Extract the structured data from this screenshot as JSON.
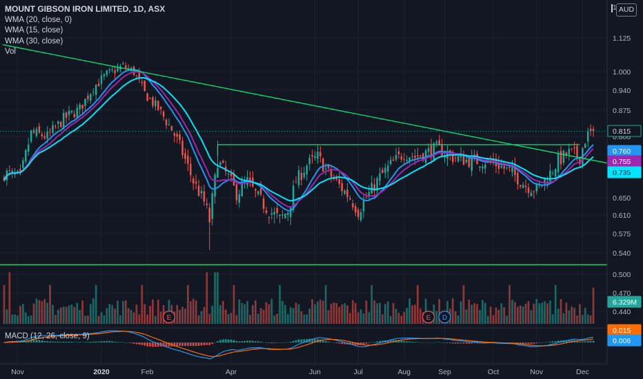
{
  "chart_data": {
    "type": "candlestick",
    "title": "MOUNT GIBSON IRON LIMITED, 1D, ASX",
    "currency": "AUD",
    "indicators": [
      "WMA (20, close, 0)",
      "WMA (15, close)",
      "WMA (30, close)",
      "Vol"
    ],
    "macd_label": "MACD (12, 26, close, 9)",
    "price_axis_ticks": [
      1.125,
      1.0,
      0.94,
      0.875,
      0.8,
      0.65,
      0.61,
      0.575,
      0.54,
      0.5,
      0.47,
      0.44
    ],
    "price_axis_labels": [
      "1.125",
      "1.000",
      "0.940",
      "0.875",
      "0.800",
      "0.650",
      "0.610",
      "0.575",
      "0.540",
      "0.500",
      "0.470",
      "0.440"
    ],
    "time_axis_labels": [
      "Nov",
      "2020",
      "Feb",
      "Apr",
      "Jun",
      "Jul",
      "Aug",
      "Sep",
      "Oct",
      "Nov",
      "Dec"
    ],
    "time_axis_index": [
      5,
      36,
      53,
      84,
      115,
      131,
      148,
      163,
      181,
      197,
      214
    ],
    "ylim": [
      0.43,
      1.17
    ],
    "bars": 219,
    "last_close": 0.815,
    "price_badges": [
      {
        "label": "0.815",
        "value": 0.815,
        "color": "#26a69a",
        "style": "outline"
      },
      {
        "label": "0.760",
        "value": 0.76,
        "color": "#2196f3",
        "style": "filled"
      },
      {
        "label": "0.755",
        "value": 0.755,
        "color": "#9c27b0",
        "style": "filled"
      },
      {
        "label": "0.735",
        "value": 0.735,
        "color": "#00e5ff",
        "style": "filled"
      }
    ],
    "volume_badge": {
      "label": "6.329M",
      "color": "#26a69a"
    },
    "macd_badges": [
      {
        "label": "0.015",
        "color": "#ff6d00"
      },
      {
        "label": "0.006",
        "color": "#2196f3"
      }
    ],
    "event_markers": [
      {
        "label": "E",
        "index": 61,
        "color": "#ef5350"
      },
      {
        "label": "E",
        "index": 157,
        "color": "#ef5350"
      },
      {
        "label": "D",
        "index": 163,
        "color": "#2196f3"
      }
    ],
    "trendlines": [
      {
        "kind": "descending",
        "from": {
          "index": 0,
          "price": 1.1
        },
        "to": {
          "index": 219,
          "price": 0.735
        },
        "color": "#00e676"
      },
      {
        "kind": "horizontal-resistance",
        "from": {
          "index": 79
        },
        "to": {
          "index": 213
        },
        "price": 0.78,
        "color": "#00e676"
      },
      {
        "kind": "horizontal-support",
        "price": 0.518,
        "color": "#00e676"
      }
    ],
    "price_path": [
      [
        0,
        0.71
      ],
      [
        6,
        0.7
      ],
      [
        10,
        0.81
      ],
      [
        16,
        0.8
      ],
      [
        22,
        0.85
      ],
      [
        28,
        0.88
      ],
      [
        33,
        0.95
      ],
      [
        38,
        0.99
      ],
      [
        44,
        1.02
      ],
      [
        48,
        1.0
      ],
      [
        52,
        0.93
      ],
      [
        57,
        0.88
      ],
      [
        62,
        0.82
      ],
      [
        66,
        0.76
      ],
      [
        70,
        0.69
      ],
      [
        74,
        0.64
      ],
      [
        76,
        0.6
      ],
      [
        79,
        0.74
      ],
      [
        83,
        0.7
      ],
      [
        86,
        0.66
      ],
      [
        90,
        0.69
      ],
      [
        94,
        0.65
      ],
      [
        98,
        0.62
      ],
      [
        102,
        0.6
      ],
      [
        105,
        0.62
      ],
      [
        108,
        0.69
      ],
      [
        112,
        0.73
      ],
      [
        116,
        0.75
      ],
      [
        120,
        0.71
      ],
      [
        124,
        0.68
      ],
      [
        128,
        0.65
      ],
      [
        131,
        0.62
      ],
      [
        135,
        0.66
      ],
      [
        139,
        0.7
      ],
      [
        143,
        0.73
      ],
      [
        148,
        0.76
      ],
      [
        152,
        0.75
      ],
      [
        156,
        0.76
      ],
      [
        160,
        0.77
      ],
      [
        166,
        0.75
      ],
      [
        172,
        0.74
      ],
      [
        178,
        0.74
      ],
      [
        183,
        0.73
      ],
      [
        188,
        0.71
      ],
      [
        193,
        0.68
      ],
      [
        197,
        0.67
      ],
      [
        201,
        0.7
      ],
      [
        205,
        0.74
      ],
      [
        209,
        0.76
      ],
      [
        213,
        0.75
      ],
      [
        216,
        0.815
      ]
    ]
  }
}
